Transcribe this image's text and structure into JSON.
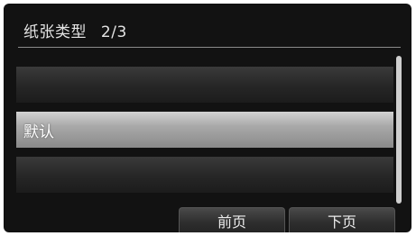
{
  "header": {
    "title": "纸张类型",
    "page_indicator": "2/3"
  },
  "list": {
    "items": [
      {
        "label": "",
        "selected": false
      },
      {
        "label": "默认",
        "selected": true
      },
      {
        "label": "",
        "selected": false
      }
    ],
    "scroll_position_fraction": 0.5,
    "scroll_visible_fraction": 1.0
  },
  "footer": {
    "prev_label": "前页",
    "next_label": "下页"
  },
  "colors": {
    "background": "#121212",
    "selected_row": "#b0b0b0",
    "text": "#e0e0e0"
  }
}
